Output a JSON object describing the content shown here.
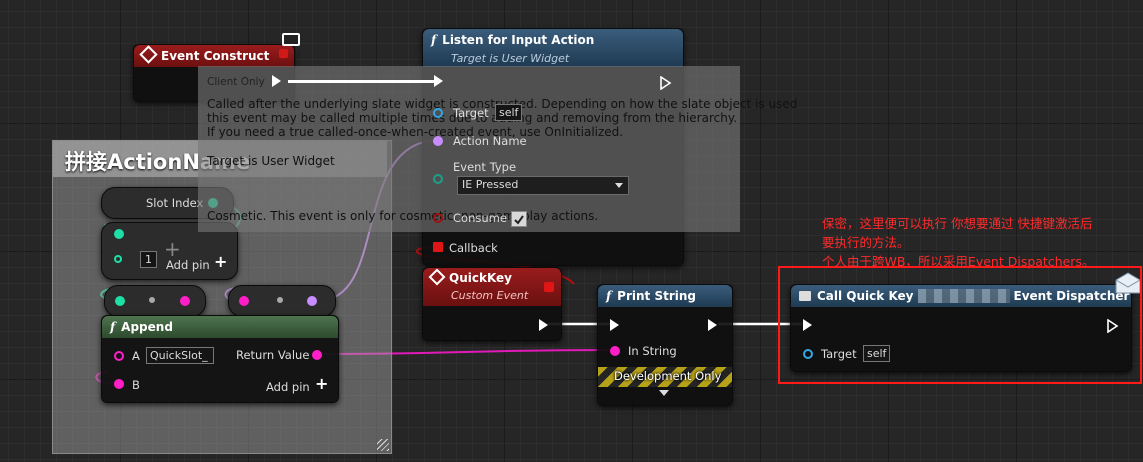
{
  "event_construct": {
    "title": "Event Construct"
  },
  "tooltip": {
    "tag": "Client Only",
    "line1": "Called after the underlying slate widget is constructed.  Depending on how the slate object is used",
    "line2": "this event may be called multiple times due to adding and removing from the hierarchy.",
    "line3": "If you need a true called-once-when-created event, use OnInitialized.",
    "target": "Target is User Widget",
    "cosmetic": "Cosmetic. This event is only for cosmetic, non-gameplay actions."
  },
  "listen_node": {
    "title": "Listen for Input Action",
    "subtitle": "Target is User Widget",
    "target_label": "Target",
    "target_value": "self",
    "action_name_label": "Action Name",
    "event_type_label": "Event Type",
    "event_type_value": "IE Pressed",
    "consume_label": "Consume",
    "callback_label": "Callback"
  },
  "comment": {
    "title": "拼接ActionName"
  },
  "slot_index": {
    "label": "Slot Index",
    "value": "1",
    "add_pin": "Add pin"
  },
  "append_node": {
    "title": "Append",
    "a_label": "A",
    "a_value": "QuickSlot_",
    "b_label": "B",
    "return_label": "Return Value",
    "add_pin": "Add pin"
  },
  "quickkey_node": {
    "title": "QuickKey",
    "subtitle": "Custom Event"
  },
  "print_node": {
    "title": "Print String",
    "in_string": "In String",
    "dev_only": "Development Only"
  },
  "dispatcher_node": {
    "title_left": "Call Quick Key",
    "title_right": "Event Dispatcher",
    "target_label": "Target",
    "target_value": "self"
  },
  "annotation": {
    "line1": "保密，这里便可以执行 你想要通过 快捷键激活后",
    "line2": "要执行的方法。",
    "line3": "个人由于跨WB，所以采用Event Dispatchers。"
  },
  "colors": {
    "event_red": "#8a1818",
    "function_blue": "#2a4a66",
    "append_green": "#3b5a3b",
    "annotation_red": "#ff2020",
    "string_pin": "#ff1ec8",
    "name_pin": "#c98cff",
    "int_pin": "#1de0a6",
    "object_pin": "#33a8e6"
  }
}
